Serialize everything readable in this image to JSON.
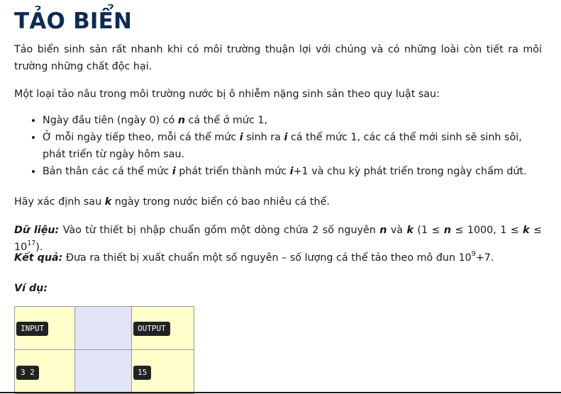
{
  "title": "TẢO BIỂN",
  "intro": "Tảo biển sinh sản rất nhanh khi có môi trường thuận lợi với chúng và có những loài còn tiết ra môi trường những chất độc hại.",
  "rule_intro": "Một loại tảo nâu trong môi trường nước bị ô nhiễm nặng sinh sản theo quy luật sau:",
  "rules": {
    "r1_a": "Ngày đầu tiên (ngày 0) có ",
    "r1_var": "n",
    "r1_b": " cá thể ở mức 1,",
    "r2_a": "Ở mỗi ngày tiếp theo, mỗi cá thể mức ",
    "r2_var1": "i",
    "r2_b": " sinh ra ",
    "r2_var2": "i",
    "r2_c": " cá thể mức 1, các cá thể mới sinh sẽ sinh sôi, phát triển từ ngày hôm sau.",
    "r3_a": "Bản thân các cá thể mức ",
    "r3_var1": "i",
    "r3_b": " phát triển thành mức ",
    "r3_var2": "i",
    "r3_c": "+1 và chu kỳ phát triển trong ngày chấm dứt."
  },
  "question": {
    "a": "Hãy xác định sau ",
    "var": "k",
    "b": " ngày trong nước biển có bao nhiêu cá thể."
  },
  "input_spec": {
    "label": "Dữ liệu:",
    "a": " Vào từ thiết bị nhập chuẩn gồm một dòng chứa 2 số nguyên ",
    "var_n": "n",
    "b": " và ",
    "var_k": "k",
    "c": " (1 ≤ ",
    "var_n2": "n",
    "d": " ≤ 1000, 1 ≤ ",
    "var_k2": "k",
    "e": " ≤ 10",
    "exp": "17",
    "f": ")."
  },
  "output_spec": {
    "label": "Kết quả:",
    "a": " Đưa ra thiết bị xuất chuẩn một số nguyên – số lượng cá thể  tảo theo mô đun 10",
    "exp": "9",
    "b": "+7."
  },
  "example_label": "Ví dụ:",
  "example": {
    "input_header": "INPUT",
    "output_header": "OUTPUT",
    "input_value": "3 2",
    "output_value": "15"
  },
  "colors": {
    "title": "#0d2b57",
    "table_yellow": "#ffffcc",
    "table_lavender": "#e1e3f7",
    "tag_bg": "#222222"
  }
}
